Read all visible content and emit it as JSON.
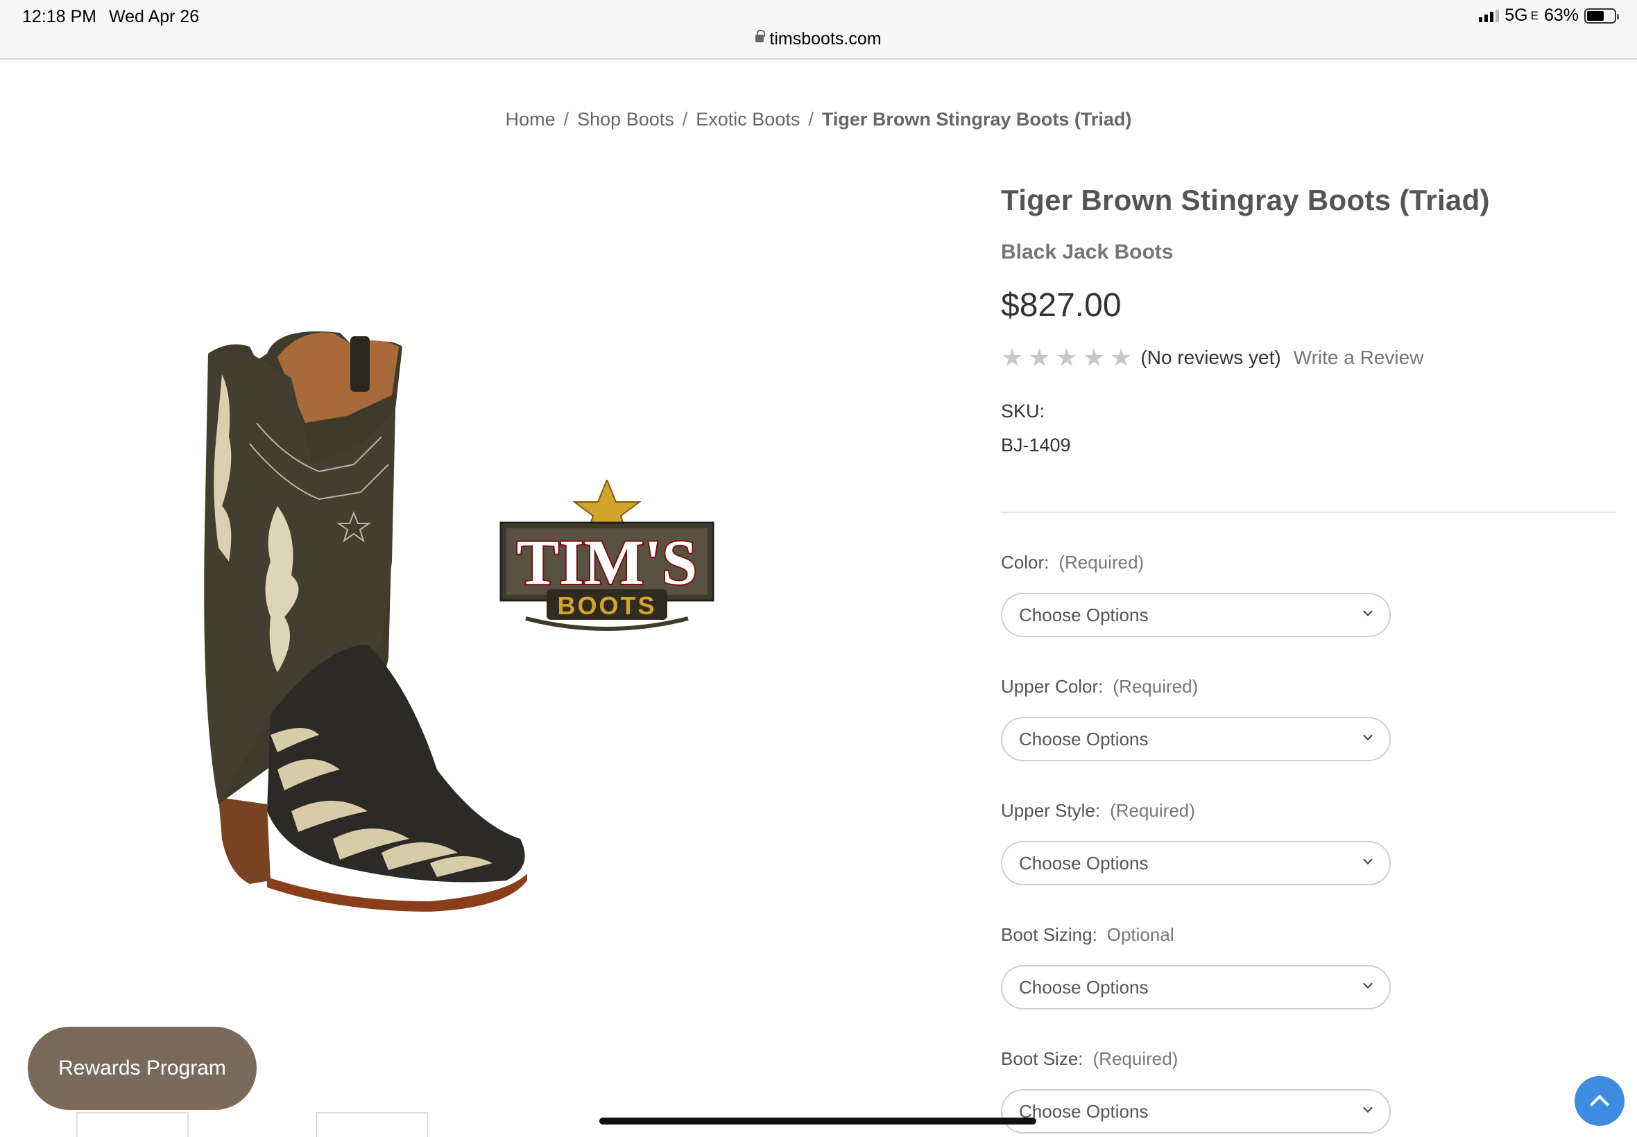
{
  "status_bar": {
    "time": "12:18 PM",
    "date": "Wed Apr 26",
    "network": "5G",
    "network_suffix": "E",
    "battery": "63%",
    "battery_level": 0.63
  },
  "browser": {
    "url": "timsboots.com"
  },
  "breadcrumb": {
    "items": [
      "Home",
      "Shop Boots",
      "Exotic Boots"
    ],
    "current": "Tiger Brown Stingray Boots (Triad)",
    "separator": "/"
  },
  "product": {
    "title": "Tiger Brown Stingray Boots (Triad)",
    "brand": "Black Jack Boots",
    "price": "$827.00",
    "rating_stars": 0,
    "reviews_text": "(No reviews yet)",
    "write_review": "Write a Review",
    "sku_label": "SKU:",
    "sku_value": "BJ-1409",
    "logo_text_top": "TIM'S",
    "logo_text_bottom": "BOOTS"
  },
  "options": [
    {
      "label": "Color:",
      "required": "(Required)",
      "value": "Choose Options"
    },
    {
      "label": "Upper Color:",
      "required": "(Required)",
      "value": "Choose Options"
    },
    {
      "label": "Upper Style:",
      "required": "(Required)",
      "value": "Choose Options"
    },
    {
      "label": "Boot Sizing:",
      "required": "Optional",
      "value": "Choose Options"
    },
    {
      "label": "Boot Size:",
      "required": "(Required)",
      "value": "Choose Options"
    }
  ],
  "rewards_button": "Rewards Program",
  "colors": {
    "rewards_bg": "#7a6a5a",
    "to_top_bg": "#3d8ce2",
    "title": "#545454"
  }
}
